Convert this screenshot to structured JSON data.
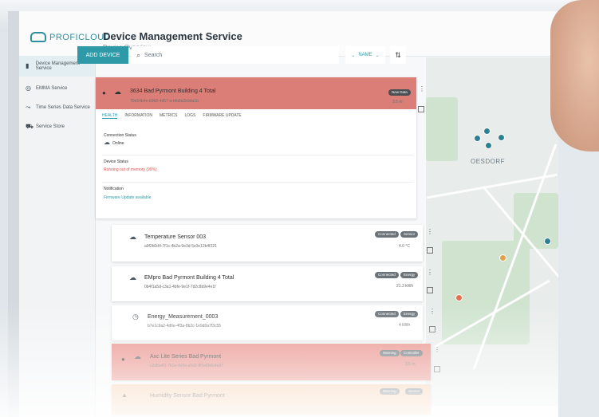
{
  "header": {
    "logo_text": "PROFICLOUD",
    "title": "Device Management Service",
    "subtitle": "Device Overview"
  },
  "sidebar": {
    "items": [
      {
        "label": "Device Management Service",
        "icon": "device-icon"
      },
      {
        "label": "EMMA Service",
        "icon": "emma-icon"
      },
      {
        "label": "Time Series Data Service",
        "icon": "timeseries-icon"
      },
      {
        "label": "Service Store",
        "icon": "store-icon"
      }
    ]
  },
  "toolbar": {
    "add_label": "ADD DEVICE",
    "search_placeholder": "Search",
    "sort_label": "NAME"
  },
  "expanded_device": {
    "name": "3634 Bad Pyrmont Building 4 Total",
    "id": "70e54b4e-b9b8-4d57-a-bfa9a2b9da1b",
    "badge": "New Data",
    "meta": "3.5 m",
    "tabs": [
      "HEALTH",
      "INFORMATION",
      "METRICS",
      "LOGS",
      "FIRMWARE UPDATE"
    ],
    "connection_title": "Connection Status",
    "connection_value": "Online",
    "device_status_title": "Device Status",
    "device_status_value": "Running out of memory (99%)",
    "notification_title": "Notification",
    "notification_value": "Firmware Update available"
  },
  "devices": [
    {
      "name": "Temperature Sensor 003",
      "id": "a9f2b0d4-7f1c-4b2a-9e3d-5c0e12b4f221",
      "badges": [
        "Connected",
        "Sensor"
      ],
      "meta": "4.0 °C"
    },
    {
      "name": "EMpro Bad Pyrmont Building 4 Total",
      "id": "0b4f1a5d-c3a1-4bfe-9e1f-7d2c8b9e4e1f",
      "badges": [
        "Connected",
        "Energy"
      ],
      "meta": "21.3 kWh"
    },
    {
      "name": "Energy_Measurement_0003",
      "id": "b7e1c9a2-4d6e-4f3a-8b2c-1e9d0a7f3c55",
      "badges": [
        "Connected",
        "Energy"
      ],
      "meta": "4 kWh"
    },
    {
      "name": "Axc Lite Series Bad Pyrmont",
      "id": "c2d8a4f1-7b3e-4c9a-a5d2-8f1e6b0c4a37",
      "badges": [
        "Warning",
        "Controller"
      ],
      "meta": "3.5 m"
    },
    {
      "name": "Humidity Sensor Bad Pyrmont",
      "id": "d9f3b2e7-1a4c-4d8b-9e6f-2c7a5b1d0e83",
      "badges": [
        "Warning",
        "Sensor"
      ],
      "meta": ""
    }
  ],
  "map": {
    "place_label": "OESDORF"
  },
  "colors": {
    "accent": "#2e9aa8",
    "error_card": "#db7e78",
    "status_error_text": "#d9534f",
    "status_link_text": "#2e9aa8"
  }
}
